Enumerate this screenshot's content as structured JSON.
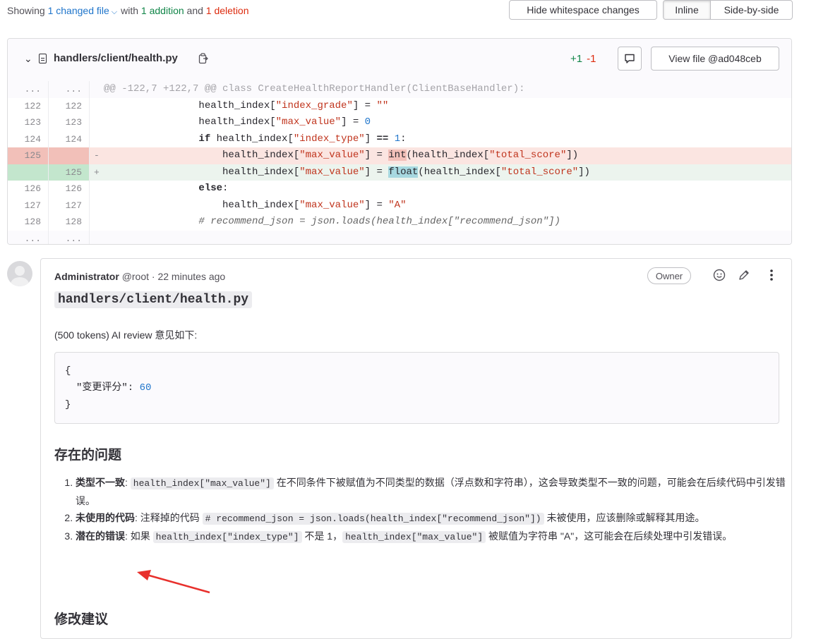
{
  "summary": {
    "prefix": "Showing",
    "files_link": "1 changed file",
    "with": "with",
    "additions": "1 addition",
    "and": "and",
    "deletions": "1 deletion"
  },
  "toolbar": {
    "hide_whitespace": "Hide whitespace changes",
    "inline": "Inline",
    "side_by_side": "Side-by-side"
  },
  "file": {
    "path": "handlers/client/health.py",
    "added": "+1",
    "removed": "-1",
    "view_file": "View file @ad048ceb"
  },
  "diff": {
    "hunk_header": "@@ -122,7 +122,7 @@ class CreateHealthReportHandler(ClientBaseHandler):",
    "ellipsis": "...",
    "lines": [
      {
        "old": "122",
        "new": "122",
        "type": "ctx"
      },
      {
        "old": "123",
        "new": "123",
        "type": "ctx"
      },
      {
        "old": "124",
        "new": "124",
        "type": "ctx"
      },
      {
        "old": "125",
        "new": "",
        "type": "old",
        "sign": "-"
      },
      {
        "old": "",
        "new": "125",
        "type": "new",
        "sign": "+"
      },
      {
        "old": "126",
        "new": "126",
        "type": "ctx"
      },
      {
        "old": "127",
        "new": "127",
        "type": "ctx"
      },
      {
        "old": "128",
        "new": "128",
        "type": "ctx"
      }
    ],
    "code": {
      "l1a": "                health_index[",
      "l1b": "\"index_grade\"",
      "l1c": "] = ",
      "l1d": "\"\"",
      "l2a": "                health_index[",
      "l2b": "\"max_value\"",
      "l2c": "] = ",
      "l2d": "0",
      "l3a": "                ",
      "l3kw": "if",
      "l3b": " health_index[",
      "l3c": "\"index_type\"",
      "l3d": "] ",
      "l3eq": "==",
      "l3e": " ",
      "l3f": "1",
      "l3g": ":",
      "l4a": "                    health_index[",
      "l4b": "\"max_value\"",
      "l4c": "] = ",
      "l4hl": "int",
      "l4d": "(health_index[",
      "l4e": "\"total_score\"",
      "l4f": "])",
      "l5a": "                    health_index[",
      "l5b": "\"max_value\"",
      "l5c": "] = ",
      "l5hl": "float",
      "l5d": "(health_index[",
      "l5e": "\"total_score\"",
      "l5f": "])",
      "l6a": "                ",
      "l6kw": "else",
      "l6b": ":",
      "l7a": "                    health_index[",
      "l7b": "\"max_value\"",
      "l7c": "] = ",
      "l7d": "\"A\"",
      "l8a": "                ",
      "l8cm": "# recommend_json = json.loads(health_index[\"recommend_json\"])"
    }
  },
  "note": {
    "author": "Administrator",
    "meta": "@root · 22 minutes ago",
    "role": "Owner",
    "file_path": "handlers/client/health.py",
    "intro": "(500 tokens) AI review 意见如下:",
    "json_open": "{",
    "json_key": "\"变更评分\": ",
    "json_val": "60",
    "json_close": "}",
    "issues_heading": "存在的问题",
    "issues": [
      {
        "title": "类型不一致",
        "sep": ": ",
        "code": "health_index[\"max_value\"]",
        "text": " 在不同条件下被赋值为不同类型的数据（浮点数和字符串），这会导致类型不一致的问题，可能会在后续代码中引发错误。"
      },
      {
        "title": "未使用的代码",
        "sep": ": 注释掉的代码 ",
        "code": "# recommend_json = json.loads(health_index[\"recommend_json\"])",
        "text": " 未被使用，应该删除或解释其用途。"
      },
      {
        "title": "潜在的错误",
        "sep": ": 如果 ",
        "code": "health_index[\"index_type\"]",
        "mid": " 不是 1，",
        "code2": "health_index[\"max_value\"]",
        "text": " 被赋值为字符串 \"A\"，这可能会在后续处理中引发错误。"
      }
    ],
    "suggest_heading": "修改建议"
  },
  "colors": {
    "link": "#1f75cb",
    "addition": "#108548",
    "deletion": "#dd2b0e",
    "annotation_arrow": "#e8302c"
  }
}
